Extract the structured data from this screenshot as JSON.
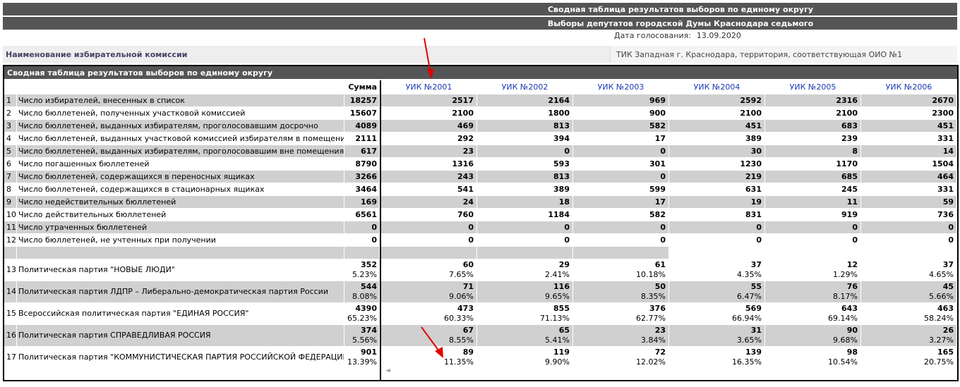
{
  "header": {
    "title": "Сводная таблица результатов выборов по единому округу",
    "subtitle": "Выборы депутатов городской Думы Краснодара седьмого созыва",
    "date_label": "Дата голосования:",
    "date_value": "13.09.2020"
  },
  "commission": {
    "label": "Наименование избирательной комиссии",
    "value": "ТИК Западная г. Краснодара, территория, соответствующая ОИО №1"
  },
  "table": {
    "title": "Сводная таблица результатов выборов по единому округу",
    "sum_header": "Сумма",
    "uik_headers": [
      "УИК №2001",
      "УИК №2002",
      "УИК №2003",
      "УИК №2004",
      "УИК №2005",
      "УИК №2006"
    ],
    "rows": [
      {
        "n": "1",
        "name": "Число избирателей, внесенных в список",
        "sum": "18257",
        "vals": [
          "2517",
          "2164",
          "969",
          "2592",
          "2316",
          "2670"
        ]
      },
      {
        "n": "2",
        "name": "Число бюллетеней, полученных участковой комиссией",
        "sum": "15607",
        "vals": [
          "2100",
          "1800",
          "900",
          "2100",
          "2100",
          "2300"
        ]
      },
      {
        "n": "3",
        "name": "Число бюллетеней, выданных избирателям, проголосовавшим досрочно",
        "sum": "4089",
        "vals": [
          "469",
          "813",
          "582",
          "451",
          "683",
          "451"
        ]
      },
      {
        "n": "4",
        "name": "Число бюллетеней, выданных участковой комиссией избирателям в помещении",
        "sum": "2111",
        "vals": [
          "292",
          "394",
          "17",
          "389",
          "239",
          "331"
        ]
      },
      {
        "n": "5",
        "name": "Число бюллетеней, выданных избирателям, проголосовавшим вне помещения",
        "sum": "617",
        "vals": [
          "23",
          "0",
          "0",
          "30",
          "8",
          "14"
        ]
      },
      {
        "n": "6",
        "name": "Число погашенных бюллетеней",
        "sum": "8790",
        "vals": [
          "1316",
          "593",
          "301",
          "1230",
          "1170",
          "1504"
        ]
      },
      {
        "n": "7",
        "name": "Число бюллетеней, содержащихся в переносных ящиках",
        "sum": "3266",
        "vals": [
          "243",
          "813",
          "0",
          "219",
          "685",
          "464"
        ]
      },
      {
        "n": "8",
        "name": "Число бюллетеней, содержащихся в стационарных ящиках",
        "sum": "3464",
        "vals": [
          "541",
          "389",
          "599",
          "631",
          "245",
          "331"
        ]
      },
      {
        "n": "9",
        "name": "Число недействительных бюллетеней",
        "sum": "169",
        "vals": [
          "24",
          "18",
          "17",
          "19",
          "11",
          "59"
        ]
      },
      {
        "n": "10",
        "name": "Число действительных бюллетеней",
        "sum": "6561",
        "vals": [
          "760",
          "1184",
          "582",
          "831",
          "919",
          "736"
        ]
      },
      {
        "n": "11",
        "name": "Число утраченных бюллетеней",
        "sum": "0",
        "vals": [
          "0",
          "0",
          "0",
          "0",
          "0",
          "0"
        ]
      },
      {
        "n": "12",
        "name": "Число бюллетеней, не учтенных при получении",
        "sum": "0",
        "vals": [
          "0",
          "0",
          "0",
          "0",
          "0",
          "0"
        ]
      }
    ],
    "parties": [
      {
        "n": "13",
        "name": "Политическая партия \"НОВЫЕ ЛЮДИ\"",
        "sum": "352",
        "sum_pct": "5.23%",
        "vals": [
          "60",
          "29",
          "61",
          "37",
          "12",
          "37"
        ],
        "pcts": [
          "7.65%",
          "2.41%",
          "10.18%",
          "4.35%",
          "1.29%",
          "4.65%"
        ]
      },
      {
        "n": "14",
        "name": "Политическая партия ЛДПР – Либерально-демократическая партия России",
        "sum": "544",
        "sum_pct": "8.08%",
        "vals": [
          "71",
          "116",
          "50",
          "55",
          "76",
          "45"
        ],
        "pcts": [
          "9.06%",
          "9.65%",
          "8.35%",
          "6.47%",
          "8.17%",
          "5.66%"
        ]
      },
      {
        "n": "15",
        "name": "Всероссийская политическая партия \"ЕДИНАЯ РОССИЯ\"",
        "sum": "4390",
        "sum_pct": "65.23%",
        "vals": [
          "473",
          "855",
          "376",
          "569",
          "643",
          "463"
        ],
        "pcts": [
          "60.33%",
          "71.13%",
          "62.77%",
          "66.94%",
          "69.14%",
          "58.24%"
        ]
      },
      {
        "n": "16",
        "name": "Политическая партия СПРАВЕДЛИВАЯ РОССИЯ",
        "sum": "374",
        "sum_pct": "5.56%",
        "vals": [
          "67",
          "65",
          "23",
          "31",
          "90",
          "26"
        ],
        "pcts": [
          "8.55%",
          "5.41%",
          "3.84%",
          "3.65%",
          "9.68%",
          "3.27%"
        ]
      },
      {
        "n": "17",
        "name": "Политическая партия \"КОММУНИСТИЧЕСКАЯ ПАРТИЯ РОССИЙСКОЙ ФЕДЕРАЦИИ\"",
        "sum": "901",
        "sum_pct": "13.39%",
        "vals": [
          "89",
          "119",
          "72",
          "139",
          "98",
          "165"
        ],
        "pcts": [
          "11.35%",
          "9.90%",
          "12.02%",
          "16.35%",
          "10.54%",
          "20.75%"
        ]
      }
    ]
  },
  "colors": {
    "bar": "#555555",
    "gray_row": "#d0d0d0",
    "link": "#1a3db0",
    "annotation": "#e00000"
  }
}
